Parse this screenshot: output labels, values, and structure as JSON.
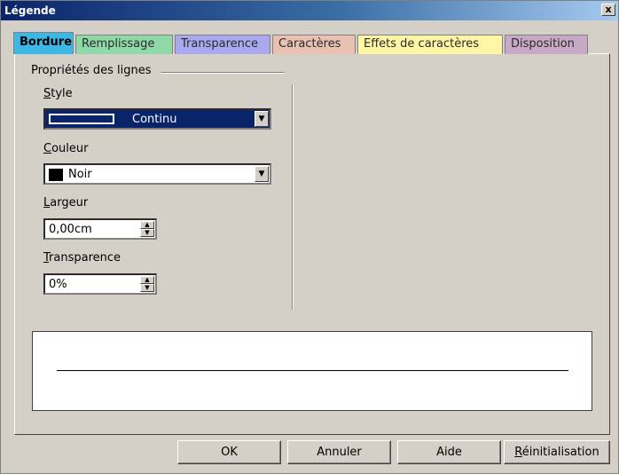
{
  "window": {
    "title": "Légende",
    "close_label": "x"
  },
  "tabs": [
    {
      "label": "Bordure",
      "color": "#3cb8e6"
    },
    {
      "label": "Remplissage",
      "color": "#8fd9a8"
    },
    {
      "label": "Transparence",
      "color": "#a9a9ef"
    },
    {
      "label": "Caractères",
      "color": "#e9c1b3"
    },
    {
      "label": "Effets de caractères",
      "color": "#fff6a6"
    },
    {
      "label": "Disposition",
      "color": "#c7a9c5"
    }
  ],
  "line_properties": {
    "group_title": "Propriétés des lignes",
    "style": {
      "label_accel": "S",
      "label_rest": "tyle",
      "value": "Continu"
    },
    "color": {
      "label_accel": "C",
      "label_rest": "ouleur",
      "value": "Noir",
      "swatch": "#000000"
    },
    "width": {
      "label_accel": "L",
      "label_rest": "argeur",
      "value": "0,00cm"
    },
    "transparency": {
      "label_accel": "T",
      "label_rest": "ransparence",
      "value": "0%"
    }
  },
  "buttons": {
    "ok": "OK",
    "cancel": "Annuler",
    "help": "Aide",
    "reset_accel": "R",
    "reset_rest": "éinitialisation"
  },
  "icons": {
    "dropdown": "chevron-down-icon",
    "spin_up": "arrow-up-icon",
    "spin_down": "arrow-down-icon"
  }
}
